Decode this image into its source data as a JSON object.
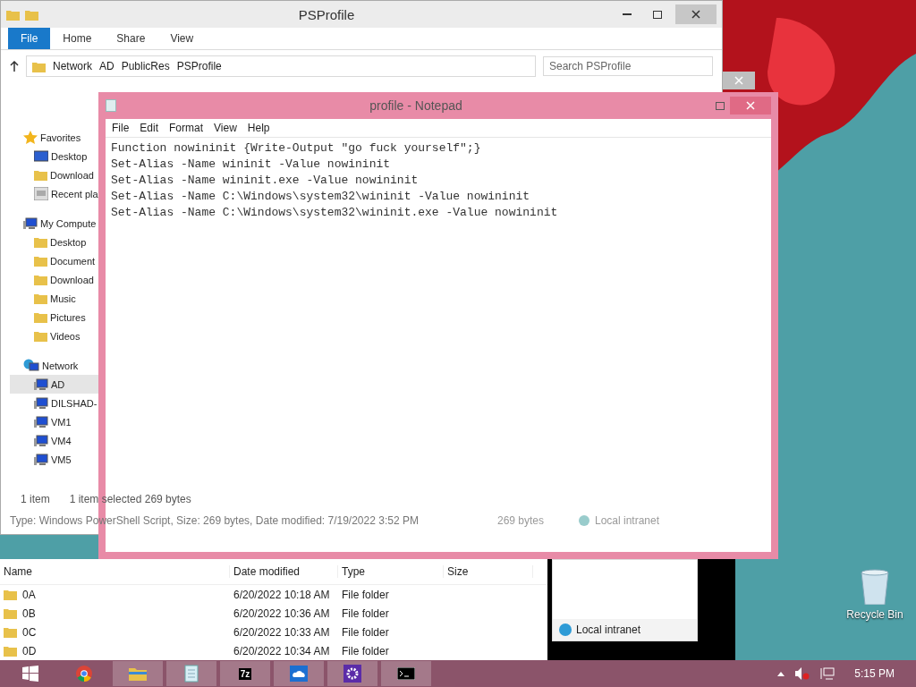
{
  "explorer": {
    "title": "PSProfile",
    "ribbon_tabs": [
      {
        "label": "File",
        "selected": true
      },
      {
        "label": "Home",
        "selected": false
      },
      {
        "label": "Share",
        "selected": false
      },
      {
        "label": "View",
        "selected": false
      }
    ],
    "address": [
      "Network",
      "AD",
      "PublicRes",
      "PSProfile"
    ],
    "search": {
      "placeholder": "Search PSProfile"
    },
    "nav": [
      {
        "label": "Favorites",
        "kind": "star",
        "children": [
          {
            "label": "Desktop",
            "kind": "desktop",
            "selected": false
          },
          {
            "label": "Download",
            "kind": "folder",
            "selected": false
          },
          {
            "label": "Recent pla",
            "kind": "recent",
            "selected": false
          }
        ]
      },
      {
        "label": "My Compute",
        "kind": "pc",
        "children": [
          {
            "label": "Desktop",
            "kind": "folder",
            "selected": false
          },
          {
            "label": "Document",
            "kind": "folder",
            "selected": false
          },
          {
            "label": "Download",
            "kind": "folder",
            "selected": false
          },
          {
            "label": "Music",
            "kind": "folder",
            "selected": false
          },
          {
            "label": "Pictures",
            "kind": "folder",
            "selected": false
          },
          {
            "label": "Videos",
            "kind": "folder",
            "selected": false
          }
        ]
      },
      {
        "label": "Network",
        "kind": "network",
        "children": [
          {
            "label": "AD",
            "kind": "pc",
            "selected": true
          },
          {
            "label": "DILSHAD-",
            "kind": "pc",
            "selected": false
          },
          {
            "label": "VM1",
            "kind": "pc",
            "selected": false
          },
          {
            "label": "VM4",
            "kind": "pc",
            "selected": false
          },
          {
            "label": "VM5",
            "kind": "pc",
            "selected": false
          }
        ]
      }
    ],
    "status": {
      "count": "1 item",
      "selection": "1 item selected  269 bytes",
      "details": "Type: Windows PowerShell Script, Size: 269 bytes, Date modified: 7/19/2022 3:52 PM",
      "size": "269 bytes",
      "zone": "Local intranet"
    }
  },
  "notepad": {
    "title": "profile - Notepad",
    "menu": [
      "File",
      "Edit",
      "Format",
      "View",
      "Help"
    ],
    "lines": [
      "Function nowininit {Write-Output \"go fuck yourself\";}",
      "Set-Alias -Name wininit -Value nowininit",
      "Set-Alias -Name wininit.exe -Value nowininit",
      "Set-Alias -Name C:\\Windows\\system32\\wininit -Value nowininit",
      "Set-Alias -Name C:\\Windows\\system32\\wininit.exe -Value nowininit"
    ]
  },
  "lower_explorer": {
    "columns": [
      "Name",
      "Date modified",
      "Type",
      "Size"
    ],
    "rows": [
      {
        "name": "0A",
        "date": "6/20/2022 10:18 AM",
        "type": "File folder"
      },
      {
        "name": "0B",
        "date": "6/20/2022 10:36 AM",
        "type": "File folder"
      },
      {
        "name": "0C",
        "date": "6/20/2022 10:33 AM",
        "type": "File folder"
      },
      {
        "name": "0D",
        "date": "6/20/2022 10:34 AM",
        "type": "File folder"
      }
    ],
    "zone": "Local intranet"
  },
  "desktop_icons": [
    {
      "label": "Recycle Bin"
    }
  ],
  "taskbar": {
    "apps": [
      {
        "kind": "start",
        "active": false
      },
      {
        "kind": "chrome",
        "active": false
      },
      {
        "kind": "explorer",
        "active": true
      },
      {
        "kind": "notepad",
        "active": true
      },
      {
        "kind": "archive",
        "label": "7z",
        "active": true
      },
      {
        "kind": "cloud",
        "active": true
      },
      {
        "kind": "gear",
        "active": true
      },
      {
        "kind": "console",
        "active": true
      }
    ],
    "clock": "5:15 PM"
  }
}
